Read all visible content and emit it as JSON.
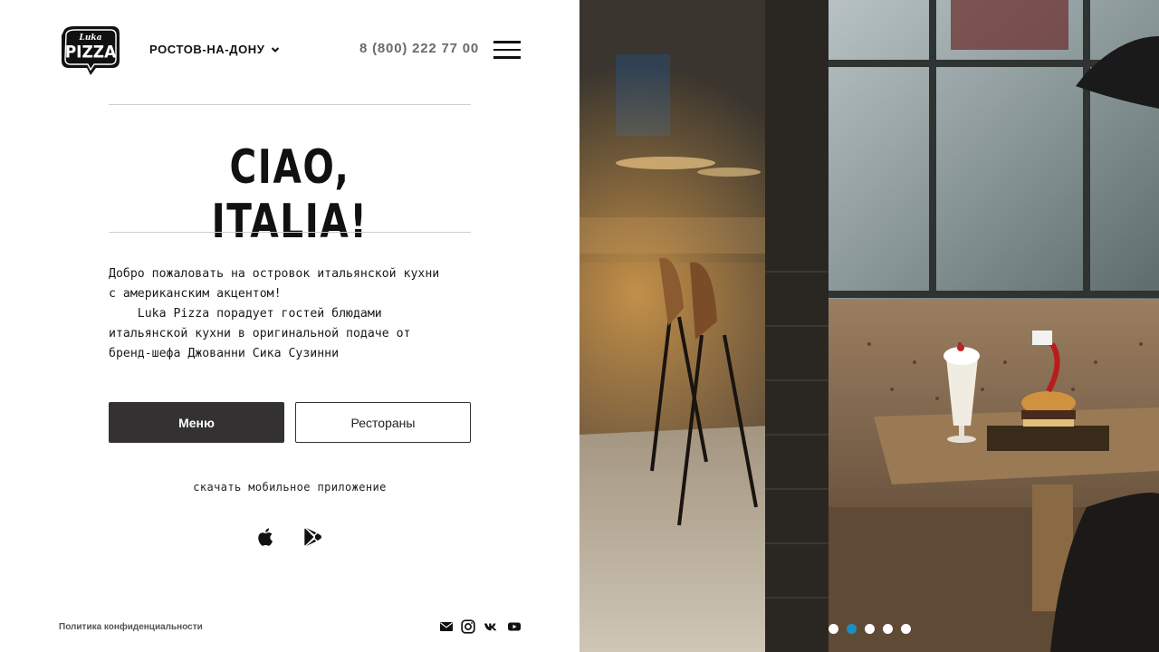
{
  "header": {
    "logo_alt": "Luka Pizza",
    "city": "РОСТОВ-НА-ДОНУ",
    "phone": "8 (800) 222 77 00"
  },
  "hero": {
    "title": "CIAO, ITALIA!",
    "intro": "Добро пожаловать на островок итальянской кухни\nс американским акцентом!\n    Luka Pizza порадует гостей блюдами\nитальянской кухни в оригинальной подаче от\nбренд-шефа Джованни Сика Сузинни"
  },
  "buttons": {
    "menu": "Меню",
    "restaurants": "Рестораны"
  },
  "app": {
    "label": "скачать мобильное приложение",
    "icons": [
      "apple-icon",
      "google-play-icon"
    ]
  },
  "footer": {
    "privacy": "Политика конфиденциальности",
    "social_icons": [
      "mail-icon",
      "instagram-icon",
      "vk-icon",
      "youtube-icon"
    ]
  },
  "slider": {
    "count": 5,
    "active_index": 1,
    "active_color": "#1a8fc4"
  },
  "colors": {
    "primary_button": "#333131",
    "text": "#1a1a1a"
  }
}
